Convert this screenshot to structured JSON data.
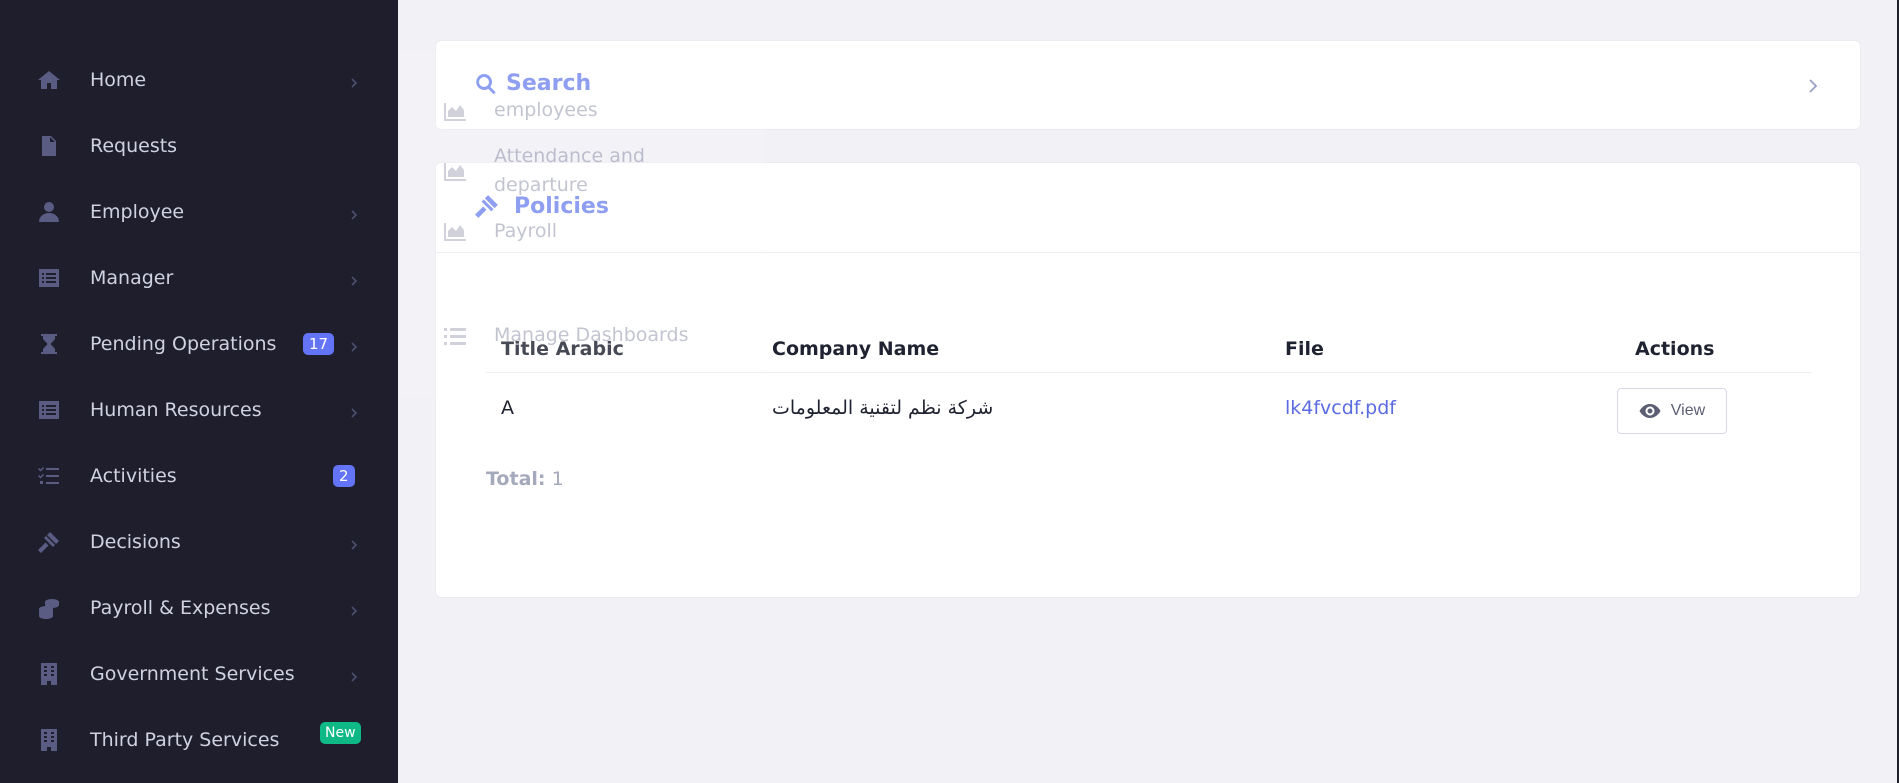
{
  "sidebar": {
    "items": [
      {
        "label": "Home",
        "icon": "home-icon",
        "chevron": true
      },
      {
        "label": "Requests",
        "icon": "document-icon",
        "chevron": false
      },
      {
        "label": "Employee",
        "icon": "user-icon",
        "chevron": true
      },
      {
        "label": "Manager",
        "icon": "list-icon",
        "chevron": true
      },
      {
        "label": "Pending Operations",
        "icon": "hourglass-icon",
        "chevron": true,
        "badge": "17"
      },
      {
        "label": "Human Resources",
        "icon": "list-icon",
        "chevron": true
      },
      {
        "label": "Activities",
        "icon": "tasks-icon",
        "chevron": false,
        "badge": "2"
      },
      {
        "label": "Decisions",
        "icon": "gavel-icon",
        "chevron": true
      },
      {
        "label": "Payroll & Expenses",
        "icon": "coins-icon",
        "chevron": true
      },
      {
        "label": "Government Services",
        "icon": "building-icon",
        "chevron": true
      },
      {
        "label": "Third Party Services",
        "icon": "building-icon",
        "chevron": false,
        "badge": "New"
      }
    ]
  },
  "search": {
    "title": "Search"
  },
  "policies": {
    "title": "Policies",
    "columns": [
      "Title Arabic",
      "Company Name",
      "File",
      "Actions"
    ],
    "rows": [
      {
        "title_arabic": "A",
        "company_name": "شركة نظم لتقنية المعلومات",
        "file": "lk4fvcdf.pdf",
        "action_label": "View"
      }
    ],
    "total_label": "Total:",
    "total_value": "1"
  },
  "ghost_menu": {
    "items": [
      "employees",
      "Attendance and",
      "departure",
      "Payroll",
      "Manage Dashboards"
    ]
  },
  "colors": {
    "sidebar_bg": "#1e1e2d",
    "accent": "#7689ee",
    "badge_blue": "#6474f6",
    "badge_green": "#0fb985",
    "link": "#5b6be0"
  }
}
